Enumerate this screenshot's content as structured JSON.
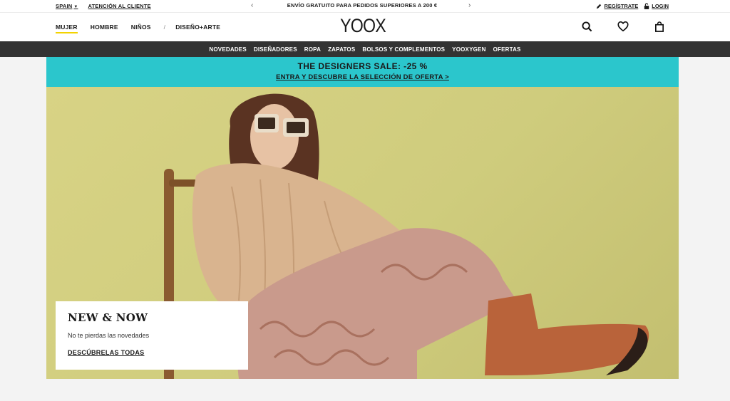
{
  "topbar": {
    "country": "SPAIN",
    "customer_service": "ATENCIÓN AL CLIENTE",
    "promo": "ENVÍO GRATUITO PARA PEDIDOS SUPERIORES A 200 €",
    "register": "REGÍSTRATE",
    "login": "LOGIN"
  },
  "header": {
    "logo": "YOOX",
    "nav": [
      "MUJER",
      "HOMBRE",
      "NIÑOS"
    ],
    "nav_separator": "/",
    "nav_extra": "DISEÑO+ARTE",
    "active": "MUJER",
    "icons": [
      "search-icon",
      "heart-icon",
      "shopping-bag-icon"
    ]
  },
  "categories": [
    "NOVEDADES",
    "DISEÑADORES",
    "ROPA",
    "ZAPATOS",
    "BOLSOS Y COMPLEMENTOS",
    "YOOXYGEN",
    "OFERTAS"
  ],
  "sale_banner": {
    "title": "THE DESIGNERS SALE: -25 %",
    "link": "ENTRA Y DESCUBRE LA SELECCIÓN DE OFERTA >",
    "color": "#2bc6cc"
  },
  "hero_card": {
    "title": "NEW & NOW",
    "subtitle": "No te pierdas las novedades",
    "cta": "DESCÚBRELAS TODAS"
  },
  "colors": {
    "active_underline": "#f3d300",
    "category_bar": "#333333"
  }
}
